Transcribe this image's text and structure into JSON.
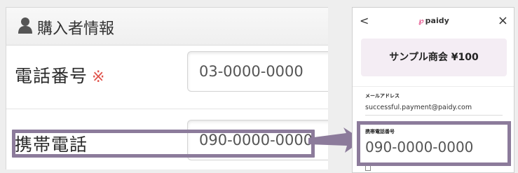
{
  "form": {
    "section_icon": "person-icon",
    "section_title": "購入者情報",
    "phone": {
      "label": "電話番号",
      "required_mark": "※",
      "value": "03-0000-0000"
    },
    "mobile": {
      "label": "携帯電話",
      "value": "090-0000-0000"
    }
  },
  "paidy": {
    "back_icon": "chevron-left-icon",
    "close_icon": "close-icon",
    "logo_text": "paidy",
    "merchant": "サンプル商会 ¥100",
    "email_label": "メールアドレス",
    "email_value": "successful.payment@paidy.com",
    "phone_label": "携帯電話番号",
    "phone_value": "090-0000-0000"
  },
  "colors": {
    "highlight": "#8c7b9b",
    "required": "#e0524a",
    "merchant_bg": "#f4edf4"
  }
}
